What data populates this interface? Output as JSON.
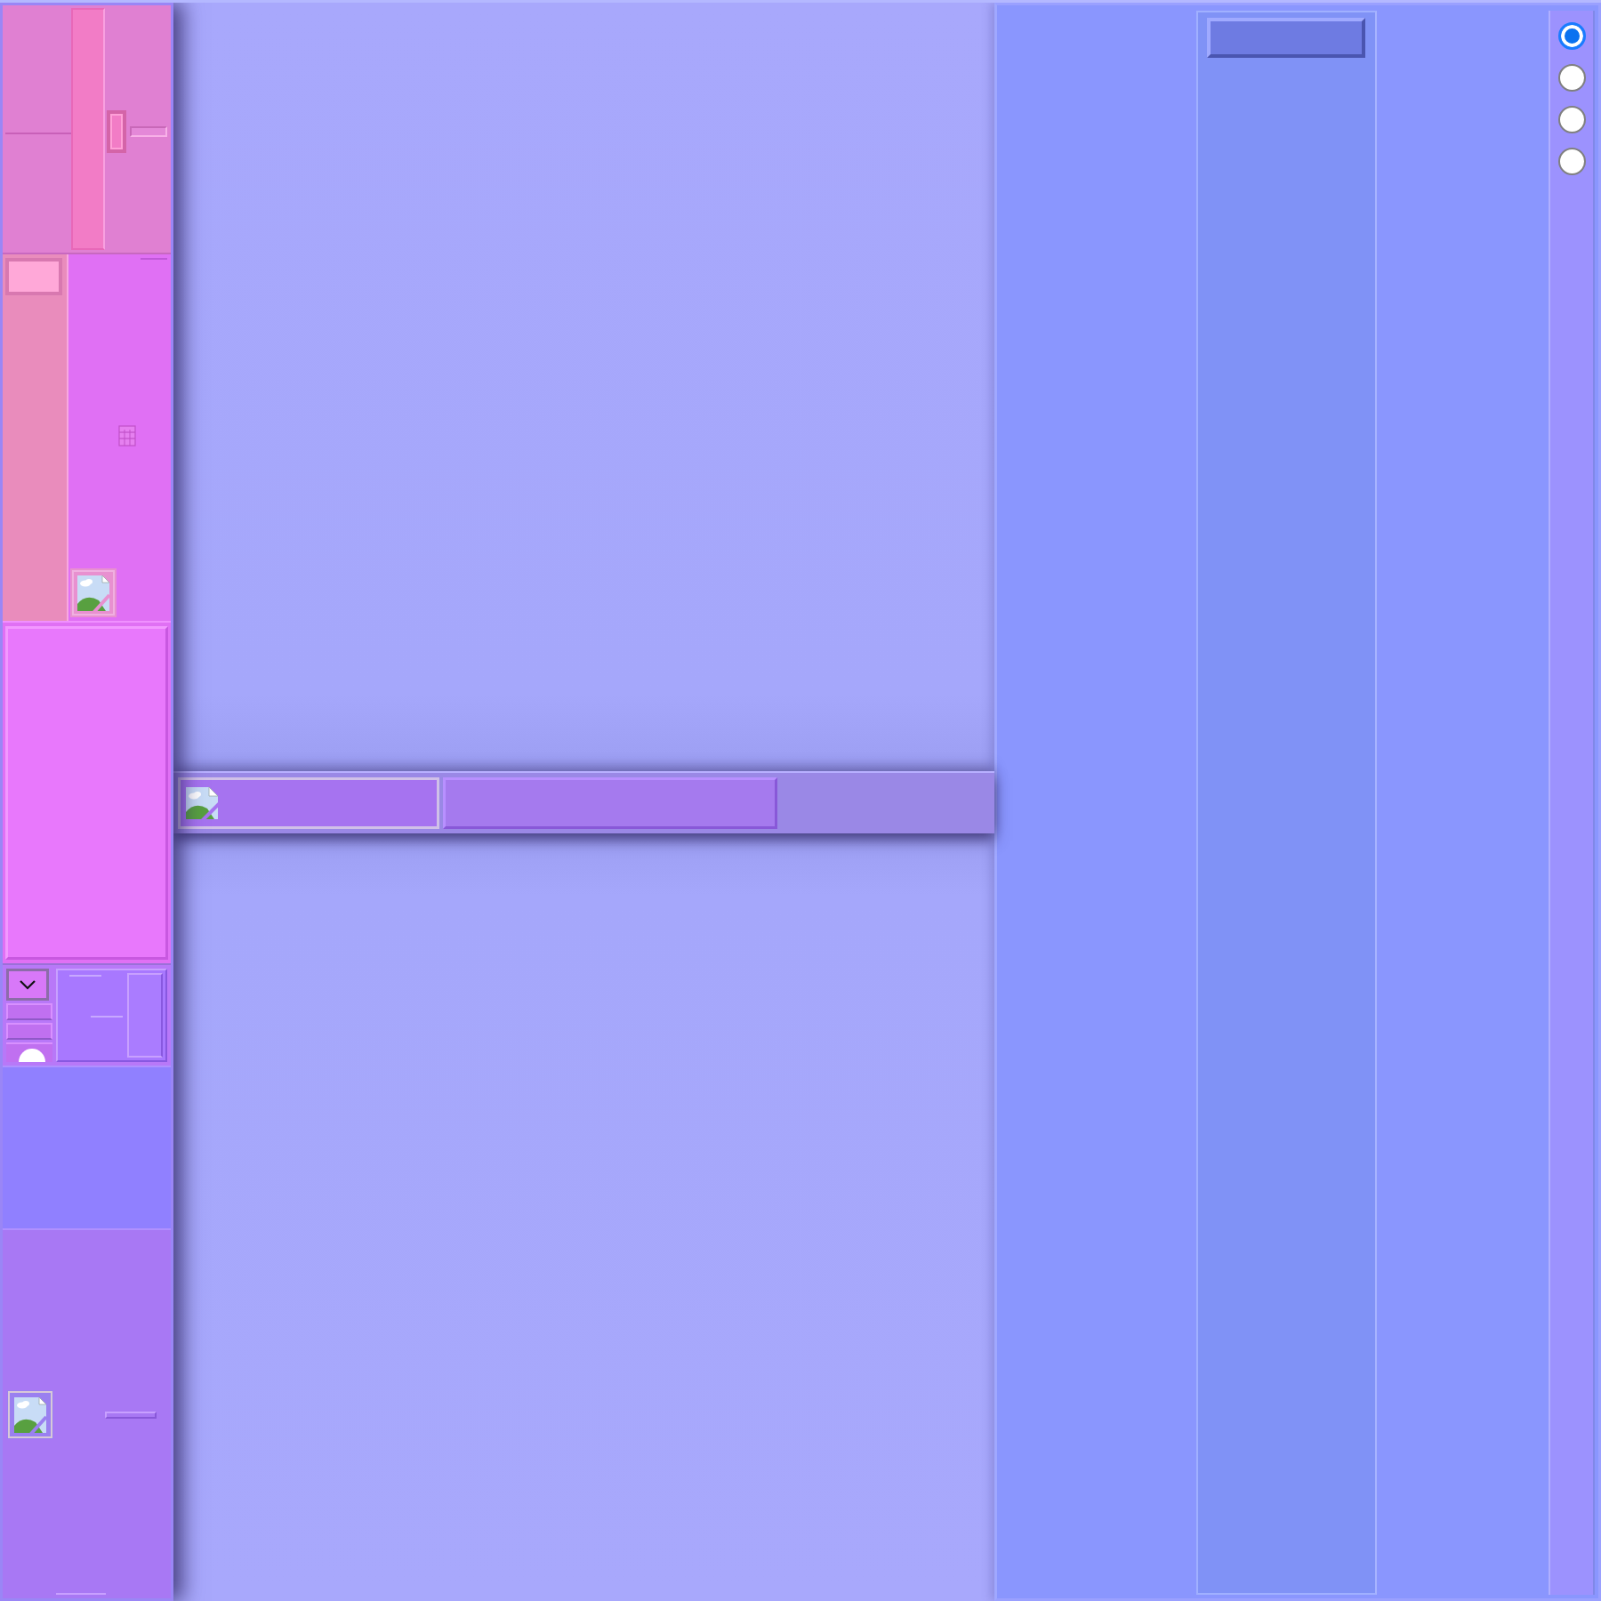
{
  "radio_group": {
    "options": [
      {
        "selected": true
      },
      {
        "selected": false
      },
      {
        "selected": false
      },
      {
        "selected": false
      }
    ]
  }
}
